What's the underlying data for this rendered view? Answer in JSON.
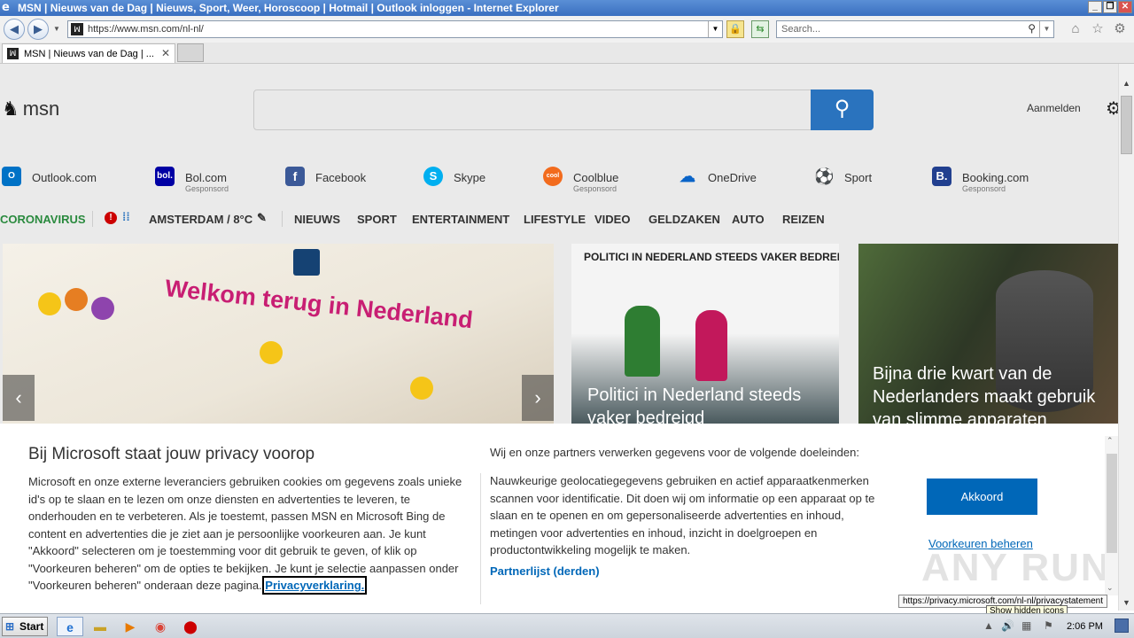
{
  "window": {
    "title": "MSN | Nieuws van de Dag | Nieuws, Sport, Weer, Horoscoop | Hotmail | Outlook inloggen - Internet Explorer"
  },
  "toolbar": {
    "url": "https://www.msn.com/nl-nl/",
    "search_placeholder": "Search..."
  },
  "tab": {
    "label": "MSN | Nieuws van de Dag | ..."
  },
  "header": {
    "logo_text": "msn",
    "signin_label": "Aanmelden"
  },
  "quicklinks": [
    {
      "label": "Outlook.com",
      "sponsored": "",
      "icon": "outlook-icon",
      "color": "#0072c6"
    },
    {
      "label": "Bol.com",
      "sponsored": "Gesponsord",
      "icon": "bol-icon",
      "color": "#0000a4"
    },
    {
      "label": "Facebook",
      "sponsored": "",
      "icon": "facebook-icon",
      "color": "#3b5998"
    },
    {
      "label": "Skype",
      "sponsored": "",
      "icon": "skype-icon",
      "color": "#00aff0"
    },
    {
      "label": "Coolblue",
      "sponsored": "Gesponsord",
      "icon": "coolblue-icon",
      "color": "#f26b1d"
    },
    {
      "label": "OneDrive",
      "sponsored": "",
      "icon": "onedrive-icon",
      "color": "#0a64c8"
    },
    {
      "label": "Sport",
      "sponsored": "",
      "icon": "sport-icon",
      "color": "#444444"
    },
    {
      "label": "Booking.com",
      "sponsored": "Gesponsord",
      "icon": "booking-icon",
      "color": "#213f8f"
    }
  ],
  "nav": {
    "coronavirus": "CORONAVIRUS",
    "weather": "AMSTERDAM / 8°C",
    "items": [
      "NIEUWS",
      "SPORT",
      "ENTERTAINMENT",
      "LIFESTYLE",
      "VIDEO",
      "GELDZAKEN",
      "AUTO",
      "REIZEN"
    ]
  },
  "tiles": [
    {
      "headline": "",
      "image_text": "Welkom terug in Nederland"
    },
    {
      "headline": "Politici in Nederland steeds vaker bedreigd",
      "image_text": "POLITICI IN NEDERLAND STEEDS VAKER BEDREIGD..."
    },
    {
      "headline": "Bijna drie kwart van de Nederlanders maakt gebruik van slimme apparaten",
      "image_text": ""
    }
  ],
  "privacy": {
    "heading": "Bij Microsoft staat jouw privacy voorop",
    "body": "Microsoft en onze externe leveranciers gebruiken cookies om gegevens zoals unieke id's op te slaan en te lezen om onze diensten en advertenties te leveren, te onderhouden en te verbeteren. Als je toestemt, passen MSN en Microsoft Bing de content en advertenties die je ziet aan je persoonlijke voorkeuren aan. Je kunt \"Akkoord\" selecteren om je toestemming voor dit gebruik te geven, of klik op \"Voorkeuren beheren\" om de opties te bekijken. Je kunt je selectie aanpassen onder \"Voorkeuren beheren\" onderaan deze pagina.",
    "link": "Privacyverklaring.",
    "heading2": "Wij en onze partners verwerken gegevens voor de volgende doeleinden:",
    "body2": "Nauwkeurige geolocatiegegevens gebruiken en actief apparaatkenmerken scannen voor identificatie. Dit doen wij om informatie op een apparaat op te slaan en te openen en om gepersonaliseerde advertenties en inhoud, metingen voor advertenties en inhoud, inzicht in doelgroepen en productontwikkeling mogelijk te maken.",
    "partner_link": "Partnerlijst (derden)",
    "accept": "Akkoord",
    "prefs": "Voorkeuren beheren"
  },
  "status": {
    "url": "https://privacy.microsoft.com/nl-nl/privacystatement",
    "tooltip": "Show hidden icons",
    "watermark": "ANY RUN"
  },
  "taskbar": {
    "start": "Start",
    "clock": "2:06 PM"
  }
}
